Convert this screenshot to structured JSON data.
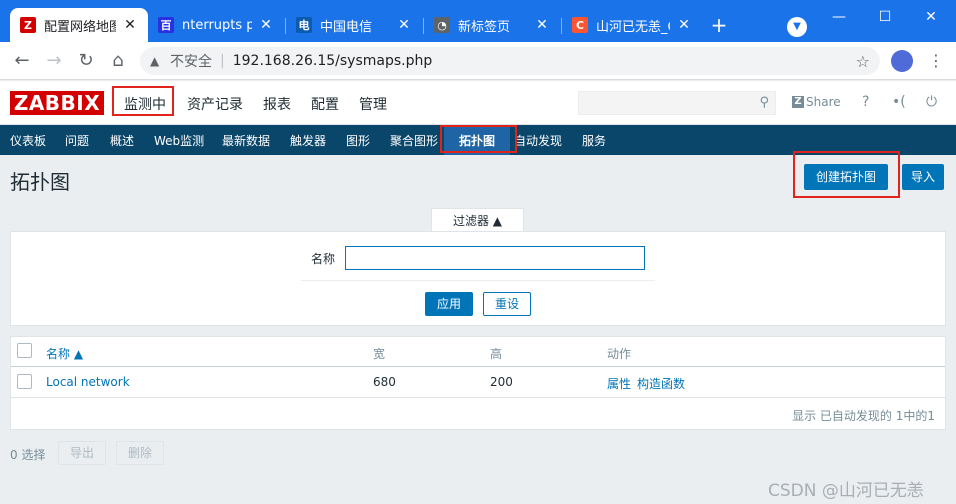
{
  "browser": {
    "tabs": [
      {
        "title": "配置网络地图",
        "favicon": "Z",
        "color": "#d40000"
      },
      {
        "title": "nterrupts per",
        "favicon": "百",
        "color": "#2932e1"
      },
      {
        "title": "中国电信",
        "favicon": "电",
        "color": "#0b5cad"
      },
      {
        "title": "新标签页",
        "favicon": "◔",
        "color": "#5f6368"
      },
      {
        "title": "山河已无恙_C",
        "favicon": "C",
        "color": "#fc5531"
      }
    ],
    "address": {
      "insecure_label": "不安全",
      "url": "192.168.26.15/sysmaps.php"
    }
  },
  "header": {
    "logo": "ZABBIX",
    "menu": [
      "监测中",
      "资产记录",
      "报表",
      "配置",
      "管理"
    ],
    "share_label": "Share",
    "help": "?"
  },
  "subnav": [
    "仪表板",
    "问题",
    "概述",
    "Web监测",
    "最新数据",
    "触发器",
    "图形",
    "聚合图形",
    "拓扑图",
    "自动发现",
    "服务"
  ],
  "page": {
    "title": "拓扑图",
    "create_button": "创建拓扑图",
    "import_button": "导入"
  },
  "filter": {
    "tab_label": "过滤器 ▲",
    "name_label": "名称",
    "name_value": "",
    "apply": "应用",
    "reset": "重设"
  },
  "table": {
    "headers": {
      "name": "名称 ▲",
      "width": "宽",
      "height": "高",
      "actions": "动作"
    },
    "rows": [
      {
        "name": "Local network",
        "width": "680",
        "height": "200",
        "action1": "属性",
        "action2": "构造函数"
      }
    ],
    "footer": "显示 已自动发现的 1中的1"
  },
  "bottom": {
    "selected": "0 选择",
    "export": "导出",
    "delete": "删除"
  },
  "watermark": "CSDN @山河已无恙"
}
